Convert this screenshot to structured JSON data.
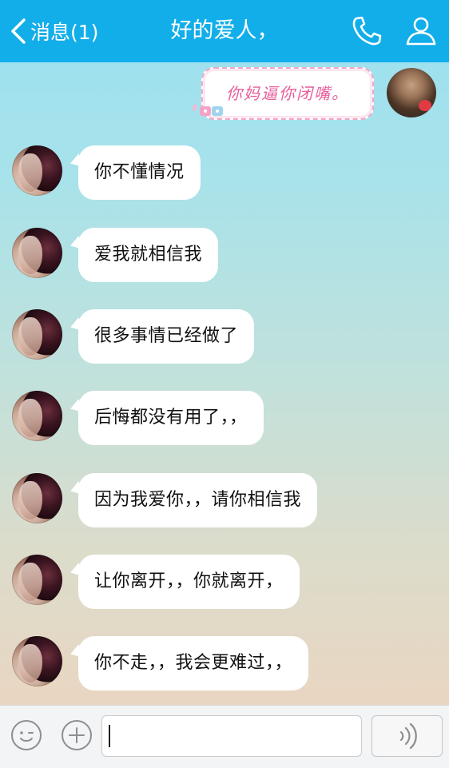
{
  "header": {
    "back_label": "消息(1)",
    "title": "好的爱人，"
  },
  "sent_message": {
    "text": "你妈逼你闭嘴。"
  },
  "messages": [
    {
      "text": "你不懂情况"
    },
    {
      "text": "爱我就相信我"
    },
    {
      "text": "很多事情已经做了"
    },
    {
      "text": "后悔都没有用了，，"
    },
    {
      "text": "因为我爱你，，请你相信我"
    },
    {
      "text": "让你离开，，你就离开，"
    },
    {
      "text": "你不走，，我会更难过，，"
    }
  ],
  "input": {
    "value": ""
  },
  "icons": {
    "back": "chevron-left-icon",
    "phone": "phone-icon",
    "contact": "person-icon",
    "emoji": "smiley-icon",
    "plus": "plus-icon",
    "voice": "voice-wave-icon"
  },
  "colors": {
    "topbar": "#12aee9",
    "bubble": "#ffffff",
    "sent_text": "#e75e9c"
  }
}
